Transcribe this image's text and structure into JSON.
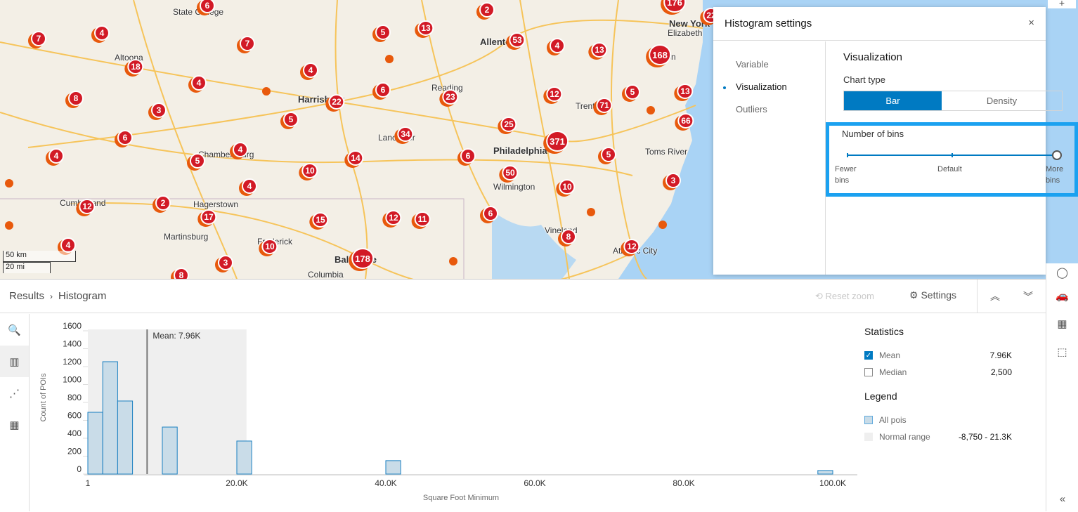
{
  "map": {
    "clusters": [
      "7",
      "4",
      "18",
      "8",
      "3",
      "6",
      "4",
      "4",
      "7",
      "4",
      "5",
      "13",
      "2",
      "53",
      "4",
      "13",
      "168",
      "6",
      "22",
      "23",
      "12",
      "5",
      "13",
      "71",
      "5",
      "34",
      "25",
      "66",
      "371",
      "4",
      "5",
      "14",
      "10",
      "6",
      "5",
      "50",
      "3",
      "4",
      "10",
      "12",
      "2",
      "17",
      "15",
      "12",
      "11",
      "6",
      "4",
      "10",
      "8",
      "12",
      "3",
      "178",
      "8",
      "6",
      "176",
      "22"
    ],
    "cities": [
      "State College",
      "Altoona",
      "Harrisburg",
      "Allentown",
      "Reading",
      "Lancaster",
      "Philadelphia",
      "Trenton",
      "Elizabeth",
      "New York",
      "Edison",
      "Toms River",
      "Wilmington",
      "Chambersburg",
      "Hagerstown",
      "Cumberland",
      "Martinsburg",
      "Frederick",
      "Vineland",
      "Atlantic City",
      "Baltimore",
      "Columbia"
    ],
    "scale": {
      "km": "50 km",
      "mi": "20 mi"
    },
    "zoom_in": "+"
  },
  "settings": {
    "title": "Histogram settings",
    "close": "×",
    "nav": [
      "Variable",
      "Visualization",
      "Outliers"
    ],
    "section": "Visualization",
    "chart_type_label": "Chart type",
    "chart_types": [
      "Bar",
      "Density"
    ],
    "selected_chart_type": "Bar",
    "bins_label": "Number of bins",
    "bins_setting": "More bins",
    "bins_fewer": "Fewer bins",
    "bins_default": "Default",
    "bins_more": "More bins"
  },
  "panel": {
    "breadcrumb": [
      "Results",
      "Histogram"
    ],
    "sep": "›",
    "reset_zoom": "Reset zoom",
    "settings": "Settings",
    "statistics": "Statistics",
    "stats": [
      {
        "label": "Mean",
        "value": "7.96K",
        "checked": true
      },
      {
        "label": "Median",
        "value": "2,500",
        "checked": false
      }
    ],
    "legend": "Legend",
    "legend_items": [
      {
        "label": "All pois",
        "value": ""
      },
      {
        "label": "Normal range",
        "value": "-8,750 - 21.3K"
      }
    ]
  },
  "chart_data": {
    "type": "bar",
    "xlabel": "Square Foot Minimum",
    "ylabel": "Count of POIs",
    "ylim": [
      0,
      1600
    ],
    "yticks": [
      "0",
      "200",
      "400",
      "600",
      "800",
      "1000",
      "1200",
      "1400",
      "1600"
    ],
    "xlim": [
      1,
      100000
    ],
    "xticks": [
      {
        "v": 1,
        "label": "1"
      },
      {
        "v": 20000,
        "label": "20.0K"
      },
      {
        "v": 40000,
        "label": "40.0K"
      },
      {
        "v": 60000,
        "label": "60.0K"
      },
      {
        "v": 80000,
        "label": "80.0K"
      },
      {
        "v": 100000,
        "label": "100.0K"
      }
    ],
    "bins": [
      {
        "x0": 1,
        "x1": 2000,
        "count": 690
      },
      {
        "x0": 2000,
        "x1": 4000,
        "count": 1255
      },
      {
        "x0": 4000,
        "x1": 6000,
        "count": 816
      },
      {
        "x0": 10000,
        "x1": 12000,
        "count": 525
      },
      {
        "x0": 20000,
        "x1": 22000,
        "count": 369
      },
      {
        "x0": 40000,
        "x1": 42000,
        "count": 150
      },
      {
        "x0": 98000,
        "x1": 100000,
        "count": 40
      }
    ],
    "mean": 7960,
    "mean_label": "Mean: 7.96K",
    "normal_range": [
      -8750,
      21300
    ],
    "bar_fill": "#c9dce8",
    "bar_stroke": "#1a7fc1",
    "range_fill": "#efefef",
    "accent": "#007ac2"
  }
}
